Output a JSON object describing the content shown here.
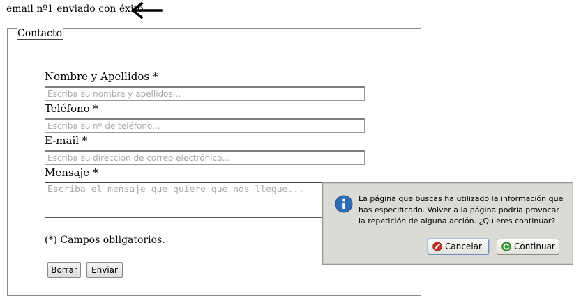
{
  "status": {
    "message": "email nº1 enviado con éxito",
    "arrow_icon": "arrow-left-icon"
  },
  "form": {
    "legend": "Contacto",
    "fields": [
      {
        "label": "Nombre y Apellidos *",
        "placeholder": "Escriba su nombre y apellidos..."
      },
      {
        "label": "Teléfono *",
        "placeholder": "Escriba su nº de teléfono..."
      },
      {
        "label": "E-mail *",
        "placeholder": "Escriba su direccion de correo electrónico..."
      },
      {
        "label": "Mensaje *",
        "placeholder": "Escriba el mensaje que quiere que nos llegue..."
      }
    ],
    "required_note": "(*) Campos obligatorios.",
    "buttons": {
      "reset": "Borrar",
      "submit": "Enviar"
    }
  },
  "dialog": {
    "icon": "info-icon",
    "message": "La página que buscas ha utilizado la información que has especificado. Volver a la página podría provocar la repetición de alguna acción. ¿Quieres continuar?",
    "cancel_label": "Cancelar",
    "continue_label": "Continuar",
    "colors": {
      "info": "#2f6db5",
      "cancel": "#c8302a",
      "continue": "#3a9a3a"
    }
  }
}
